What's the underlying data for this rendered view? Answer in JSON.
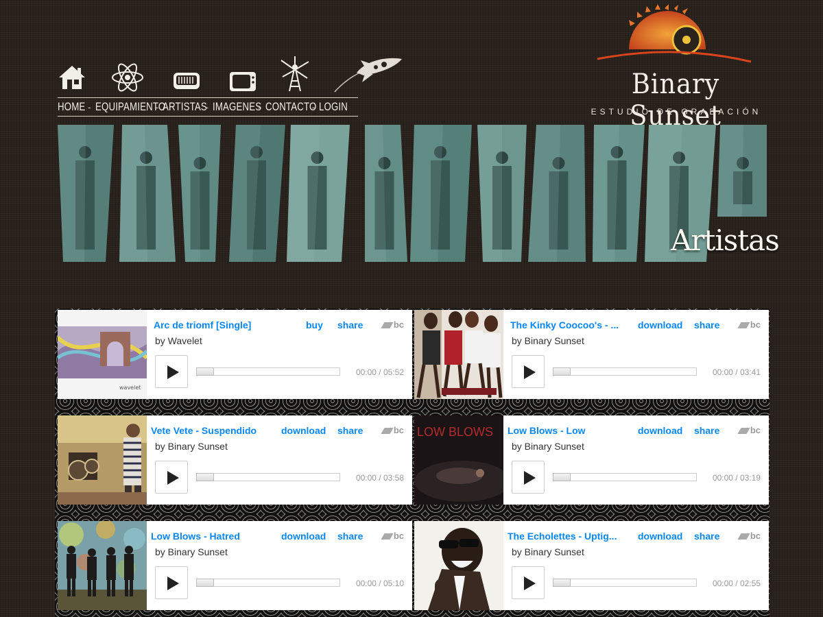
{
  "nav": {
    "links": [
      "HOME",
      "EQUIPAMIENTO",
      "ARTISTAS",
      "IMAGENES",
      "CONTACTO",
      "LOGIN"
    ],
    "separator": "-",
    "icons": [
      "house-icon",
      "atom-icon",
      "radio-icon",
      "tv-icon",
      "radio-tower-icon",
      "rocket-icon"
    ]
  },
  "logo": {
    "title": "Binary Sunset",
    "subtitle": "ESTUDIO DE GRABACIÓN"
  },
  "banner": {
    "section_title": "Artistas"
  },
  "players": [
    {
      "title": "Arc de triomf [Single]",
      "artist": "by Wavelet",
      "actions": [
        "buy",
        "share"
      ],
      "time": "00:00 / 05:52",
      "brand": "bc",
      "progress": 0
    },
    {
      "title": "The Kinky Coocoo's - ...",
      "artist": "by Binary Sunset",
      "actions": [
        "download",
        "share"
      ],
      "time": "00:00 / 03:41",
      "brand": "bc",
      "progress": 0
    },
    {
      "title": "Vete Vete - Suspendido",
      "artist": "by Binary Sunset",
      "actions": [
        "download",
        "share"
      ],
      "time": "00:00 / 03:58",
      "brand": "bc",
      "progress": 0
    },
    {
      "title": "Low Blows - Low",
      "artist": "by Binary Sunset",
      "actions": [
        "download",
        "share"
      ],
      "time": "00:00 / 03:19",
      "brand": "bc",
      "progress": 0
    },
    {
      "title": "Low Blows - Hatred",
      "artist": "by Binary Sunset",
      "actions": [
        "download",
        "share"
      ],
      "time": "00:00 / 05:10",
      "brand": "bc",
      "progress": 0
    },
    {
      "title": "The Echolettes - Uptig...",
      "artist": "by Binary Sunset",
      "actions": [
        "download",
        "share"
      ],
      "time": "00:00 / 02:55",
      "brand": "bc",
      "progress": 0
    }
  ],
  "art": {
    "low_blows_cover_text": "LOW BLOWS",
    "wavelet_signature": "wavelet"
  },
  "colors": {
    "link_blue": "#0687f5",
    "banner_teal": "#6f9e97",
    "background": "#2a221d"
  }
}
